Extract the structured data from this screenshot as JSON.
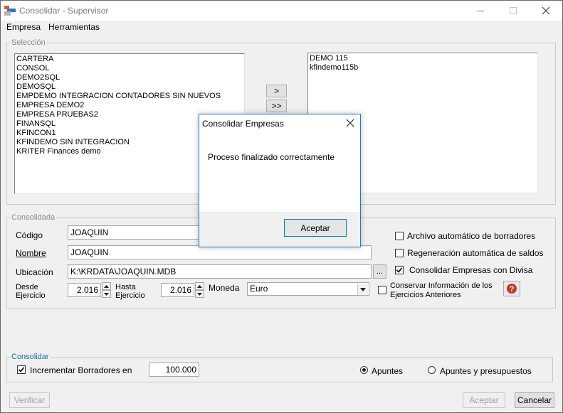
{
  "window": {
    "title": "Consolidar - Supervisor",
    "menu": [
      "Empresa",
      "Herramientas"
    ]
  },
  "seleccion": {
    "legend": "Selección",
    "available": [
      "CARTERA",
      "CONSOL",
      "DEMO2SQL",
      "DEMOSQL",
      "EMPDEMO INTEGRACION CONTADORES SIN NUEVOS",
      "EMPRESA DEMO2",
      "EMPRESA PRUEBAS2",
      "FINANSQL",
      "KFINCON1",
      "KFINDEMO SIN INTEGRACION",
      "KRITER Finances demo"
    ],
    "selected": [
      "DEMO 115",
      "kfindemo115b"
    ],
    "move_one_label": ">",
    "move_all_label": ">>"
  },
  "consolidada": {
    "legend": "Consolidada",
    "codigo_label": "Código",
    "codigo_value": "JOAQUIN",
    "nombre_label": "Nombre",
    "nombre_value": "JOAQUIN",
    "ubicacion_label": "Ubicación",
    "ubicacion_value": "K:\\KRDATA\\JOAQUIN.MDB",
    "browse_label": "...",
    "desde_label_1": "Desde",
    "desde_label_2": "Ejercicio",
    "desde_value": "2.016",
    "hasta_label_1": "Hasta",
    "hasta_label_2": "Ejercicio",
    "hasta_value": "2.016",
    "moneda_label": "Moneda",
    "moneda_value": "Euro",
    "options": [
      {
        "label": "Archivo automático de borradores",
        "checked": false
      },
      {
        "label": "Regeneración automática de saldos",
        "checked": false
      },
      {
        "label": "Consolidar Empresas con Divisa",
        "checked": true
      }
    ],
    "conservar_label_1": "Conservar Información de los",
    "conservar_label_2": "Ejercicios Anteriores",
    "conservar_checked": false
  },
  "consolidar": {
    "legend": "Consolidar",
    "incrementar_label": "Incrementar Borradores en",
    "incrementar_checked": true,
    "incrementar_value": "100.000",
    "radio_apuntes": "Apuntes",
    "radio_apuntes_presupuestos": "Apuntes y presupuestos",
    "radio_selected": "Apuntes"
  },
  "footer": {
    "verificar": "Verificar",
    "aceptar": "Aceptar",
    "cancelar": "Cancelar"
  },
  "dialog": {
    "title": "Consolidar Empresas",
    "message": "Proceso finalizado correctamente",
    "ok": "Aceptar"
  },
  "colors": {
    "accent": "#0078d7",
    "legend_blue": "#1a64b8",
    "help_red": "#c0392b"
  }
}
